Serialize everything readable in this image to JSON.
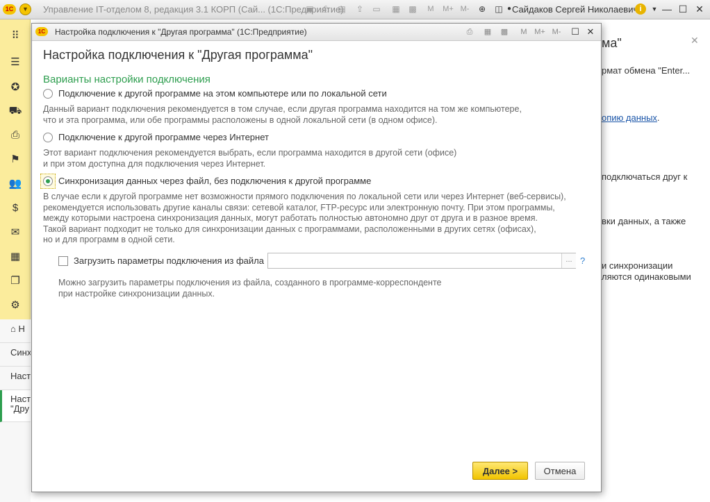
{
  "app": {
    "logo_text": "1С",
    "window_title": "Управление IT-отделом 8, редакция 3.1 КОРП (Сай... (1С:Предприятие)",
    "user": "Сайдаков Сергей Николаевич",
    "toolbar_glyphs": {
      "m": "M",
      "m_plus": "M+",
      "m_minus": "M-"
    }
  },
  "left_panel": {
    "icons": [
      "apps-grid-icon",
      "menu-icon",
      "support-icon",
      "truck-icon",
      "printer-icon",
      "flag-icon",
      "users-icon",
      "money-bag-icon",
      "envelope-icon",
      "calendar-icon",
      "documents-icon",
      "gear-icon"
    ],
    "nav_items": [
      {
        "label": "Н"
      },
      {
        "label": "Синх"
      },
      {
        "label": "Наст"
      },
      {
        "label_line1": "Наст",
        "label_line2": "\"Дру"
      }
    ]
  },
  "background_page": {
    "heading_fragment": "ма\"",
    "line1": "рмат обмена \"Enter...",
    "link": "опию данных",
    "link_suffix": ".",
    "line3": "подключаться друг к",
    "line4": "вки данных, а также",
    "line5a": "и синхронизации",
    "line5b": "ляются одинаковыми"
  },
  "dialog": {
    "window_title": "Настройка подключения к \"Другая программа\"  (1С:Предприятие)",
    "heading": "Настройка подключения к \"Другая программа\"",
    "section_title": "Варианты настройки подключения",
    "options": [
      {
        "label": "Подключение к другой программе на этом компьютере или по локальной сети",
        "checked": false,
        "desc": [
          "Данный вариант подключения рекомендуется в том случае, если другая программа находится на том же компьютере,",
          "что и эта программа, или обе программы расположены в одной локальной сети (в одном офисе)."
        ]
      },
      {
        "label": "Подключение к другой программе через Интернет",
        "checked": false,
        "desc": [
          "Этот вариант подключения рекомендуется выбрать, если программа находится в другой сети (офисе)",
          "и при этом доступна для подключения через Интернет."
        ]
      },
      {
        "label": "Синхронизация данных через файл, без подключения к другой программе",
        "checked": true,
        "desc": [
          "В случае если к другой программе нет возможности прямого подключения по локальной сети или через Интернет (веб-сервисы),",
          "рекомендуется использовать другие каналы связи: сетевой каталог, FTP-ресурс или электронную почту. При этом программы,",
          "между которыми настроена синхронизация данных, могут работать полностью автономно друг от друга и в разное время.",
          "Такой вариант подходит не только для синхронизации данных с программами, расположенными в других сетях (офисах),",
          "но и для программ в одной сети."
        ]
      }
    ],
    "load_from_file": {
      "label": "Загрузить параметры подключения из файла",
      "checked": false,
      "value": "",
      "browse_label": "...",
      "help": "?",
      "desc": [
        "Можно загрузить параметры подключения из файла, созданного в программе-корреспонденте",
        "при настройке синхронизации данных."
      ]
    },
    "buttons": {
      "next": "Далее >",
      "cancel": "Отмена"
    }
  },
  "colors": {
    "accent_green": "#2e9e4f",
    "primary_button": "#f1c400",
    "left_panel": "#fbec9c",
    "link": "#1a55a8"
  }
}
